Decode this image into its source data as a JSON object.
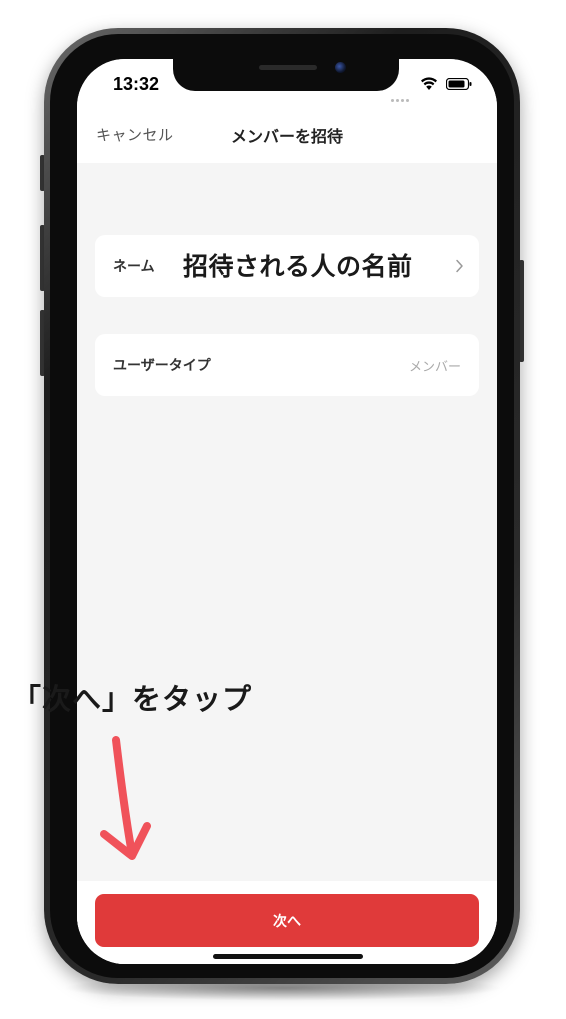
{
  "status_bar": {
    "time": "13:32",
    "wifi_icon": "wifi-icon",
    "battery_icon": "battery-icon"
  },
  "nav": {
    "cancel_label": "キャンセル",
    "title": "メンバーを招待"
  },
  "form": {
    "name_row": {
      "label": "ネーム",
      "annotation": "招待される人の名前",
      "chevron_icon": "chevron-right-icon"
    },
    "user_type_row": {
      "label": "ユーザータイプ",
      "value": "メンバー"
    }
  },
  "annotation": {
    "instruction": "「次へ」をタップ",
    "arrow_color": "#f0525a"
  },
  "footer": {
    "next_label": "次へ"
  },
  "colors": {
    "accent": "#e03a3a",
    "background": "#f5f5f5"
  }
}
